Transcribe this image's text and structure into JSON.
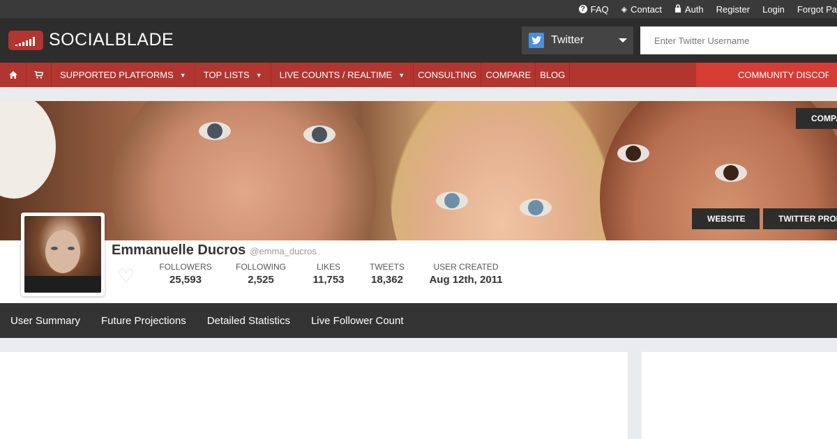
{
  "topbar": {
    "links": [
      {
        "label": "FAQ",
        "icon": "question-circle-icon"
      },
      {
        "label": "Contact",
        "icon": "tag-icon"
      },
      {
        "label": "Auth",
        "icon": "lock-icon"
      },
      {
        "label": "Register"
      },
      {
        "label": "Login"
      },
      {
        "label": "Forgot Pa"
      }
    ]
  },
  "header": {
    "logo_text": "SOCIALBLADE",
    "platform": "Twitter",
    "search_placeholder": "Enter Twitter Username"
  },
  "nav": {
    "items": [
      {
        "label": "SUPPORTED PLATFORMS",
        "dropdown": "▼"
      },
      {
        "label": "TOP LISTS",
        "dropdown": "▼"
      },
      {
        "label": "LIVE COUNTS / REALTIME",
        "dropdown": "▼"
      },
      {
        "label": "CONSULTING"
      },
      {
        "label": "COMPARE"
      },
      {
        "label": "BLOG"
      }
    ],
    "discord": "COMMUNITY DISCORD"
  },
  "banner": {
    "compare_button": "COMPA",
    "website_button": "WEBSITE",
    "profile_button": "TWITTER PROF"
  },
  "profile": {
    "name": "Emmanuelle Ducros",
    "handle": "@emma_ducros",
    "stats": [
      {
        "label": "FOLLOWERS",
        "value": "25,593"
      },
      {
        "label": "FOLLOWING",
        "value": "2,525"
      },
      {
        "label": "LIKES",
        "value": "11,753"
      },
      {
        "label": "TWEETS",
        "value": "18,362"
      },
      {
        "label": "USER CREATED",
        "value": "Aug 12th, 2011"
      }
    ]
  },
  "tabs": [
    {
      "label": "User Summary"
    },
    {
      "label": "Future Projections"
    },
    {
      "label": "Detailed Statistics"
    },
    {
      "label": "Live Follower Count"
    }
  ],
  "colors": {
    "brand_red": "#b3352f",
    "discord_red": "#d63c33",
    "dark_bar": "#333333",
    "header_bg": "#2d2d2d"
  }
}
